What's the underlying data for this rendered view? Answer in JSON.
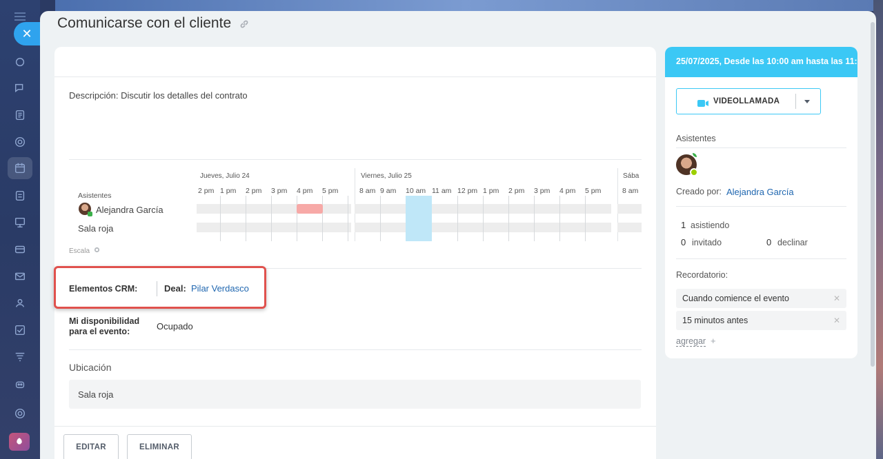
{
  "header": {
    "title": "Comunicarse con el cliente"
  },
  "description": "Descripción: Discutir los detalles del contrato",
  "planner": {
    "days": [
      "Jueves, Julio 24",
      "Viernes, Julio 25",
      "Sába"
    ],
    "hours_day1": [
      "2 pm",
      "1 pm",
      "2 pm",
      "3 pm",
      "4 pm",
      "5 pm"
    ],
    "hours_day2": [
      "8 am",
      "9 am",
      "10 am",
      "11 am",
      "12 pm",
      "1 pm",
      "2 pm",
      "3 pm",
      "4 pm",
      "5 pm"
    ],
    "hours_day3": [
      "8 am"
    ],
    "attendees_label": "Asistentes",
    "rows": [
      "Alejandra García",
      "Sala roja"
    ],
    "scale_label": "Escala"
  },
  "crm": {
    "label": "Elementos CRM:",
    "type": "Deal:",
    "value": "Pilar Verdasco"
  },
  "availability": {
    "label": "Mi disponibilidad para el evento:",
    "value": "Ocupado"
  },
  "location": {
    "label": "Ubicación",
    "value": "Sala roja"
  },
  "footer": {
    "edit": "EDITAR",
    "delete": "ELIMINAR"
  },
  "side": {
    "header": "25/07/2025, Desde las 10:00 am hasta las 11:",
    "video_label": "VIDEOLLAMADA",
    "attendees_label": "Asistentes",
    "created_by_label": "Creado por:",
    "created_by": "Alejandra García",
    "attending_count": "1",
    "attending_label": "asistiendo",
    "invited_count": "0",
    "invited_label": "invitado",
    "declined_count": "0",
    "declined_label": "declinar",
    "reminder_label": "Recordatorio:",
    "reminders": [
      "Cuando comience el evento",
      "15 minutos antes"
    ],
    "add_label": "agregar"
  },
  "colors": {
    "accent": "#3bc8f5",
    "link": "#2067b0",
    "busy": "#f7a9a7",
    "highlight": "#e0514d"
  }
}
